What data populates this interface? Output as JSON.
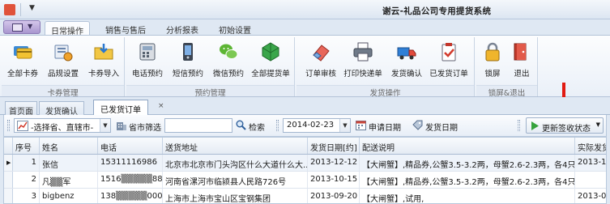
{
  "window": {
    "title": "谢云-礼品公司专用提货系统"
  },
  "ribbon_tabs": [
    {
      "label": "日常操作",
      "active": true
    },
    {
      "label": "销售与售后",
      "active": false
    },
    {
      "label": "分析报表",
      "active": false
    },
    {
      "label": "初始设置",
      "active": false
    }
  ],
  "ribbon_groups": {
    "card": {
      "label": "卡券管理",
      "buttons": [
        {
          "label": "全部卡券",
          "icon": "cards-icon"
        },
        {
          "label": "品规设置",
          "icon": "product-settings-icon"
        },
        {
          "label": "卡券导入",
          "icon": "import-folder-icon"
        }
      ]
    },
    "preorder": {
      "label": "预约管理",
      "buttons": [
        {
          "label": "电话预约",
          "icon": "phone-icon"
        },
        {
          "label": "短信预约",
          "icon": "sms-icon"
        },
        {
          "label": "微信预约",
          "icon": "wechat-icon"
        },
        {
          "label": "全部提货单",
          "icon": "all-orders-icon"
        }
      ]
    },
    "ship": {
      "label": "发货操作",
      "buttons": [
        {
          "label": "订单审核",
          "icon": "eraser-icon"
        },
        {
          "label": "打印快递单",
          "icon": "printer-icon"
        },
        {
          "label": "发货确认",
          "icon": "truck-icon"
        },
        {
          "label": "已发货订单",
          "icon": "shipped-list-icon"
        }
      ]
    },
    "lock": {
      "label": "锁屏&退出",
      "buttons": [
        {
          "label": "锁屏",
          "icon": "lock-icon"
        },
        {
          "label": "退出",
          "icon": "exit-icon"
        }
      ]
    }
  },
  "doc_tabs": [
    {
      "label": "首页面",
      "active": false
    },
    {
      "label": "发货确认",
      "active": false
    },
    {
      "label": "已发货订单",
      "active": true
    }
  ],
  "doc_close": "×",
  "toolbar": {
    "region_value": "-选择省、直辖市-",
    "province_filter_label": "省市筛选",
    "city_filter_value": "",
    "search_label": "检索",
    "date_value": "2014-02-23",
    "apply_date_label": "申请日期",
    "ship_date_label": "发货日期",
    "update_sign_label": "更新签收状态"
  },
  "grid": {
    "columns": [
      "序号",
      "姓名",
      "电话",
      "送货地址",
      "发货日期[约]",
      "配送说明",
      "实际发货"
    ],
    "rows": [
      {
        "no": "1",
        "name": "张信",
        "phone": "15311116986",
        "address": "北京市北京市门头沟区什么大道什么大...",
        "ship_date": "2013-12-12",
        "note": "【大闸蟹】,精品券,公蟹3.5-3.2两，母蟹2.6-2.3两，各4只",
        "actual": "2013-12",
        "selected": true
      },
      {
        "no": "2",
        "name": "凡▒▒军",
        "phone": "1516▒▒▒▒▒88",
        "address": "河南省漯河市临颍县人民路726号",
        "ship_date": "2013-10-15",
        "note": "【大闸蟹】,精品券,公蟹3.5-3.2两，母蟹2.6-2.3两，各4只",
        "actual": "",
        "selected": false
      },
      {
        "no": "3",
        "name": "bigbenz",
        "phone": "138▒▒▒▒▒000",
        "address": "上海市上海市宝山区宝钢集团",
        "ship_date": "2013-09-20",
        "note": "【大闸蟹】,试用,",
        "actual": "2013-09",
        "selected": false
      }
    ]
  },
  "colors": {
    "accent": "#2f6fc0",
    "annotation_arrow": "#e11a12",
    "ribbon_bg": "#eaf0f8"
  }
}
